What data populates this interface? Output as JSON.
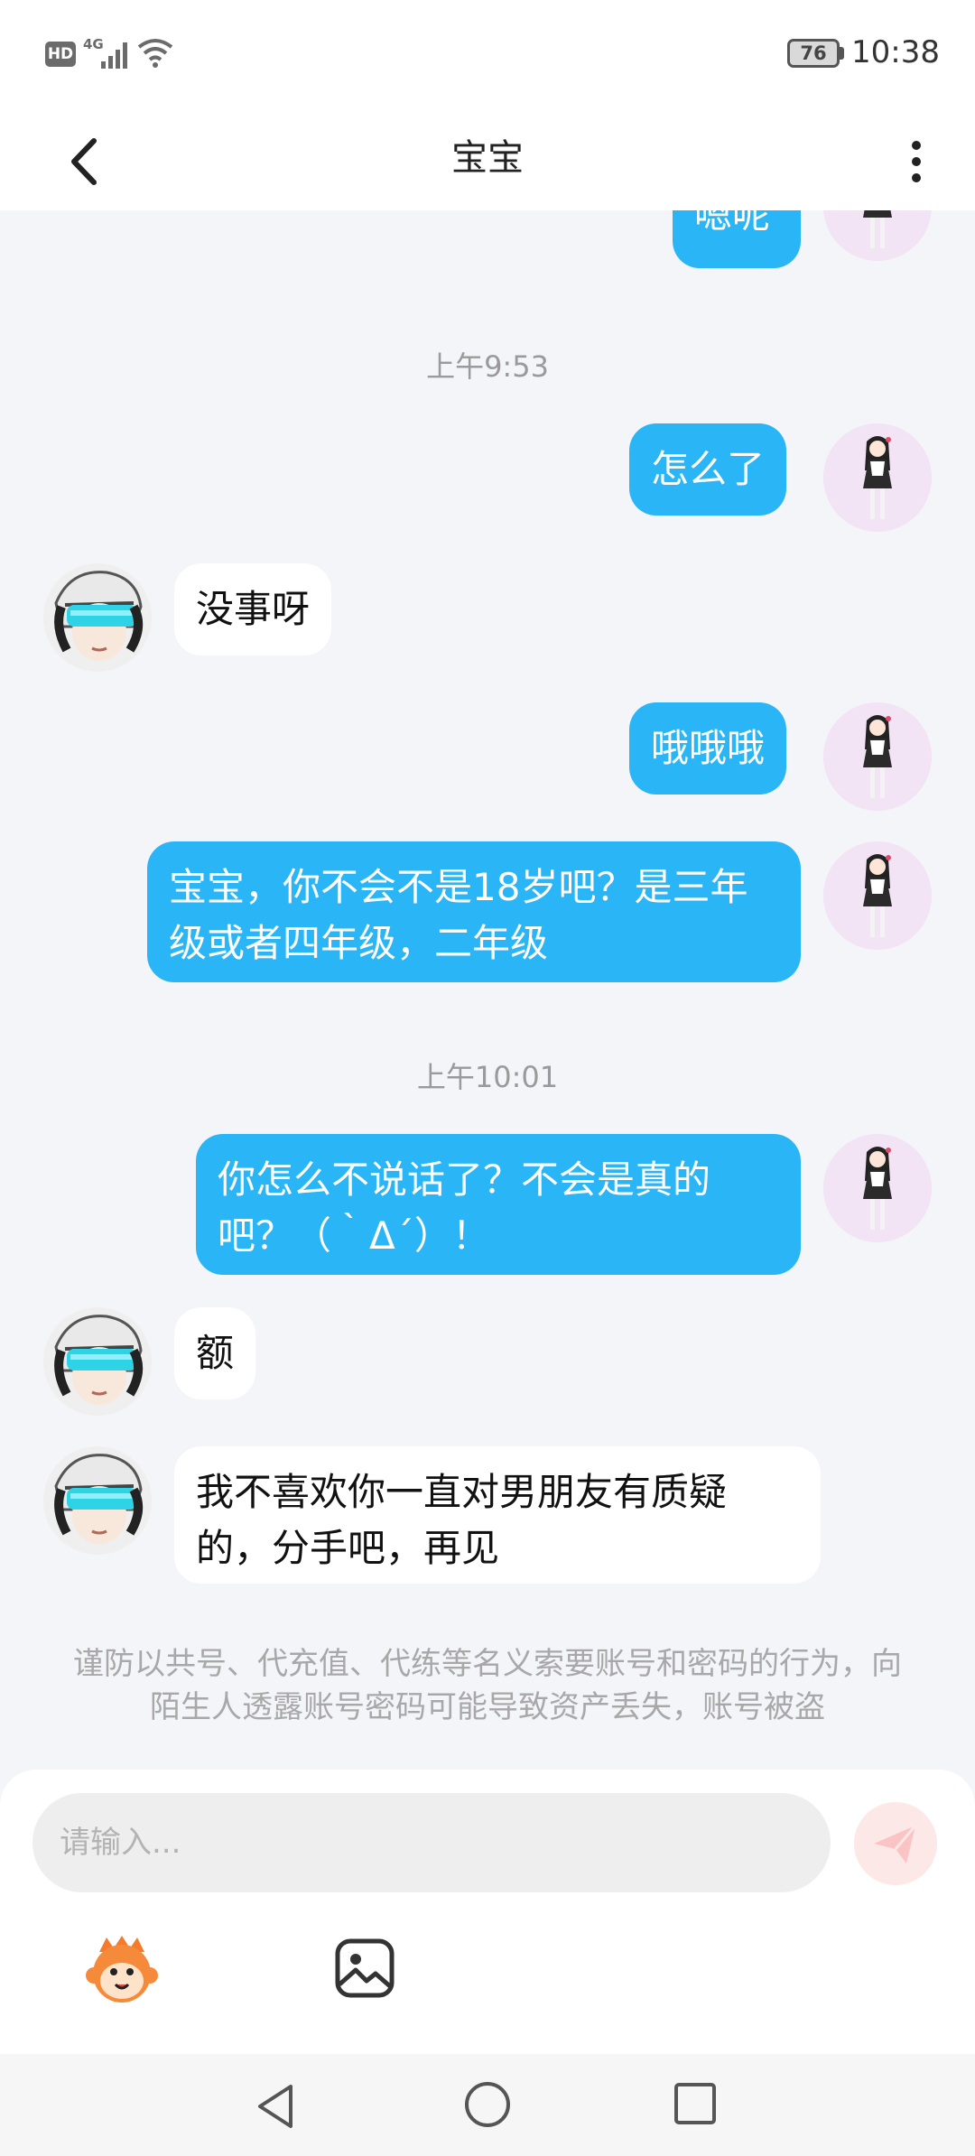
{
  "status_bar": {
    "hd_badge": "HD",
    "network_type": "4G",
    "battery_level": "76",
    "time": "10:38"
  },
  "header": {
    "title": "宝宝",
    "back_icon": "chevron-left-icon",
    "more_icon": "more-vertical-icon"
  },
  "chat": {
    "partial_top_bubble": "嗯呢",
    "timestamps": [
      "上午9:53",
      "上午10:01"
    ],
    "messages": [
      {
        "sender": "me",
        "text": "怎么了"
      },
      {
        "sender": "them",
        "text": "没事呀"
      },
      {
        "sender": "me",
        "text": "哦哦哦"
      },
      {
        "sender": "me",
        "text": "宝宝，你不会不是18岁吧？是三年级或者四年级，二年级"
      },
      {
        "sender": "me",
        "text": "你怎么不说话了？不会是真的吧？（｀Δ´）！"
      },
      {
        "sender": "them",
        "text": "额"
      },
      {
        "sender": "them",
        "text": "我不喜欢你一直对男朋友有质疑的，分手吧，再见"
      }
    ],
    "notice": "谨防以共号、代充值、代练等名义索要账号和密码的行为，向陌生人透露账号密码可能导致资产丢失，账号被盗"
  },
  "input": {
    "placeholder": "请输入...",
    "send_icon": "send-icon",
    "tools": [
      "emoji-icon",
      "image-icon"
    ]
  },
  "nav_bar": {
    "icons": [
      "nav-back-icon",
      "nav-home-icon",
      "nav-recents-icon"
    ]
  },
  "colors": {
    "my_bubble": "#2ab6f6",
    "their_bubble": "#ffffff",
    "background": "#f4f5f9",
    "send_button": "#fde8e8"
  }
}
